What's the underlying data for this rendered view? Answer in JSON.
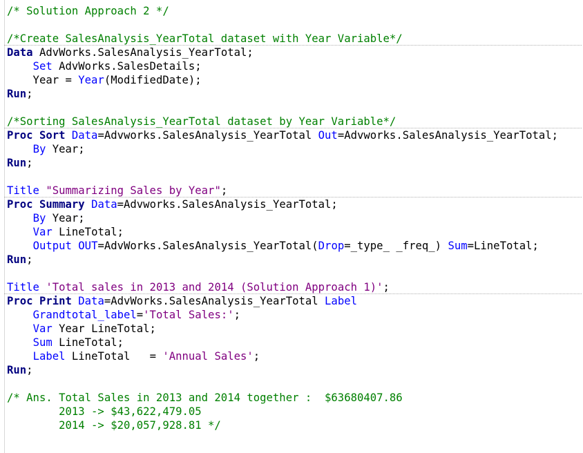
{
  "editor": {
    "lines": [
      {
        "step": false,
        "tokens": [
          {
            "c": "cm",
            "t": "/* Solution Approach 2 */"
          }
        ]
      },
      {
        "step": false,
        "tokens": []
      },
      {
        "step": false,
        "tokens": [
          {
            "c": "cm",
            "t": "/*Create SalesAnalysis_YearTotal dataset with Year Variable*/"
          }
        ]
      },
      {
        "step": true,
        "tokens": [
          {
            "c": "kw",
            "t": "Data"
          },
          {
            "c": "tx",
            "t": " AdvWorks.SalesAnalysis_YearTotal;"
          }
        ]
      },
      {
        "step": false,
        "tokens": [
          {
            "c": "tx",
            "t": "    "
          },
          {
            "c": "op",
            "t": "Set"
          },
          {
            "c": "tx",
            "t": " AdvWorks.SalesDetails;"
          }
        ]
      },
      {
        "step": false,
        "tokens": [
          {
            "c": "tx",
            "t": "    Year = "
          },
          {
            "c": "op",
            "t": "Year"
          },
          {
            "c": "tx",
            "t": "(ModifiedDate);"
          }
        ]
      },
      {
        "step": false,
        "tokens": [
          {
            "c": "kw",
            "t": "Run"
          },
          {
            "c": "tx",
            "t": ";"
          }
        ]
      },
      {
        "step": false,
        "tokens": []
      },
      {
        "step": false,
        "tokens": [
          {
            "c": "cm",
            "t": "/*Sorting SalesAnalysis_YearTotal dataset by Year Variable*/"
          }
        ]
      },
      {
        "step": true,
        "tokens": [
          {
            "c": "kw",
            "t": "Proc Sort"
          },
          {
            "c": "tx",
            "t": " "
          },
          {
            "c": "op",
            "t": "Data"
          },
          {
            "c": "tx",
            "t": "=Advworks.SalesAnalysis_YearTotal "
          },
          {
            "c": "op",
            "t": "Out"
          },
          {
            "c": "tx",
            "t": "=Advworks.SalesAnalysis_YearTotal;"
          }
        ]
      },
      {
        "step": false,
        "tokens": [
          {
            "c": "tx",
            "t": "    "
          },
          {
            "c": "op",
            "t": "By"
          },
          {
            "c": "tx",
            "t": " Year;"
          }
        ]
      },
      {
        "step": false,
        "tokens": [
          {
            "c": "kw",
            "t": "Run"
          },
          {
            "c": "tx",
            "t": ";"
          }
        ]
      },
      {
        "step": false,
        "tokens": []
      },
      {
        "step": false,
        "tokens": [
          {
            "c": "op",
            "t": "Title"
          },
          {
            "c": "tx",
            "t": " "
          },
          {
            "c": "st",
            "t": "\"Summarizing Sales by Year\""
          },
          {
            "c": "tx",
            "t": ";"
          }
        ]
      },
      {
        "step": true,
        "tokens": [
          {
            "c": "kw",
            "t": "Proc Summary"
          },
          {
            "c": "tx",
            "t": " "
          },
          {
            "c": "op",
            "t": "Data"
          },
          {
            "c": "tx",
            "t": "=Advworks.SalesAnalysis_YearTotal;"
          }
        ]
      },
      {
        "step": false,
        "tokens": [
          {
            "c": "tx",
            "t": "    "
          },
          {
            "c": "op",
            "t": "By"
          },
          {
            "c": "tx",
            "t": " Year;"
          }
        ]
      },
      {
        "step": false,
        "tokens": [
          {
            "c": "tx",
            "t": "    "
          },
          {
            "c": "op",
            "t": "Var"
          },
          {
            "c": "tx",
            "t": " LineTotal;"
          }
        ]
      },
      {
        "step": false,
        "tokens": [
          {
            "c": "tx",
            "t": "    "
          },
          {
            "c": "op",
            "t": "Output"
          },
          {
            "c": "tx",
            "t": " "
          },
          {
            "c": "op",
            "t": "OUT"
          },
          {
            "c": "tx",
            "t": "=AdvWorks.SalesAnalysis_YearTotal("
          },
          {
            "c": "op",
            "t": "Drop"
          },
          {
            "c": "tx",
            "t": "=_type_ _freq_) "
          },
          {
            "c": "op",
            "t": "Sum"
          },
          {
            "c": "tx",
            "t": "=LineTotal;"
          }
        ]
      },
      {
        "step": false,
        "tokens": [
          {
            "c": "kw",
            "t": "Run"
          },
          {
            "c": "tx",
            "t": ";"
          }
        ]
      },
      {
        "step": false,
        "tokens": []
      },
      {
        "step": false,
        "tokens": [
          {
            "c": "op",
            "t": "Title"
          },
          {
            "c": "tx",
            "t": " "
          },
          {
            "c": "st",
            "t": "'Total sales in 2013 and 2014 (Solution Approach 1)'"
          },
          {
            "c": "tx",
            "t": ";"
          }
        ]
      },
      {
        "step": true,
        "tokens": [
          {
            "c": "kw",
            "t": "Proc Print"
          },
          {
            "c": "tx",
            "t": " "
          },
          {
            "c": "op",
            "t": "Data"
          },
          {
            "c": "tx",
            "t": "=AdvWorks.SalesAnalysis_YearTotal "
          },
          {
            "c": "op",
            "t": "Label"
          }
        ]
      },
      {
        "step": false,
        "tokens": [
          {
            "c": "tx",
            "t": "    "
          },
          {
            "c": "op",
            "t": "Grandtotal_label"
          },
          {
            "c": "tx",
            "t": "="
          },
          {
            "c": "st",
            "t": "'Total Sales:'"
          },
          {
            "c": "tx",
            "t": ";"
          }
        ]
      },
      {
        "step": false,
        "tokens": [
          {
            "c": "tx",
            "t": "    "
          },
          {
            "c": "op",
            "t": "Var"
          },
          {
            "c": "tx",
            "t": " Year LineTotal;"
          }
        ]
      },
      {
        "step": false,
        "tokens": [
          {
            "c": "tx",
            "t": "    "
          },
          {
            "c": "op",
            "t": "Sum"
          },
          {
            "c": "tx",
            "t": " LineTotal;"
          }
        ]
      },
      {
        "step": false,
        "tokens": [
          {
            "c": "tx",
            "t": "    "
          },
          {
            "c": "op",
            "t": "Label"
          },
          {
            "c": "tx",
            "t": " LineTotal   = "
          },
          {
            "c": "st",
            "t": "'Annual Sales'"
          },
          {
            "c": "tx",
            "t": ";"
          }
        ]
      },
      {
        "step": false,
        "tokens": [
          {
            "c": "kw",
            "t": "Run"
          },
          {
            "c": "tx",
            "t": ";"
          }
        ]
      },
      {
        "step": false,
        "tokens": []
      },
      {
        "step": false,
        "tokens": [
          {
            "c": "cm",
            "t": "/* Ans. Total Sales in 2013 and 2014 together :  $63680407.86"
          }
        ]
      },
      {
        "step": false,
        "tokens": [
          {
            "c": "cm",
            "t": "        2013 -> $43,622,479.05"
          }
        ]
      },
      {
        "step": false,
        "tokens": [
          {
            "c": "cm",
            "t": "        2014 -> $20,057,928.81 */"
          }
        ]
      }
    ]
  },
  "colors": {
    "comment": "#008000",
    "keyword": "#000080",
    "operator": "#0000ff",
    "string": "#800080",
    "text": "#000000"
  }
}
